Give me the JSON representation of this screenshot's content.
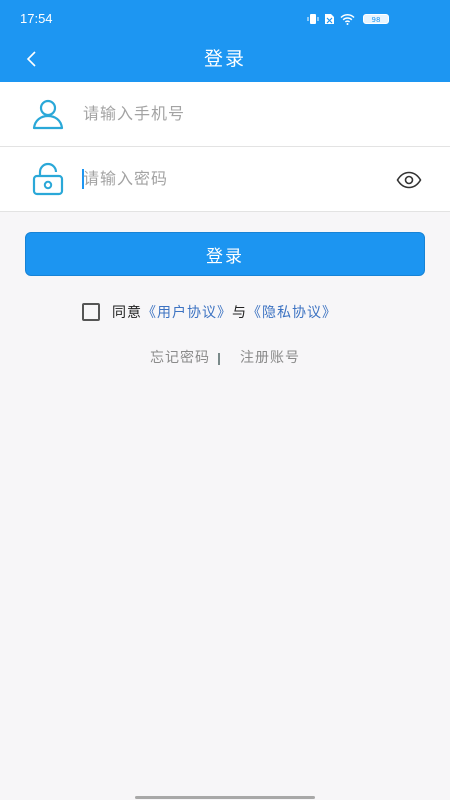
{
  "status_bar": {
    "time": "17:54",
    "battery": "98"
  },
  "header": {
    "title": "登录"
  },
  "form": {
    "phone_placeholder": "请输入手机号",
    "password_placeholder": "请输入密码"
  },
  "login_button": "登录",
  "agreement": {
    "prefix": "同意",
    "user_agreement": "《用户协议》",
    "connector": "与",
    "privacy_policy": "《隐私协议》"
  },
  "links": {
    "forgot_password": "忘记密码",
    "register": "注册账号"
  },
  "colors": {
    "primary": "#1d96f2",
    "link": "#3d73c2",
    "icon": "#2aa8d8"
  }
}
